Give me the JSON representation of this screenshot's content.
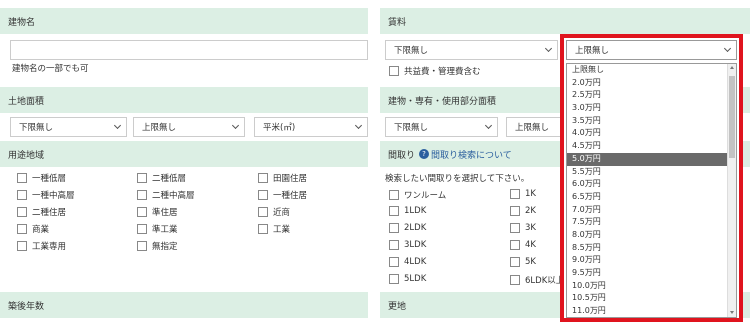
{
  "building_name": {
    "header": "建物名",
    "hint": "建物名の一部でも可"
  },
  "rent": {
    "header": "賃料",
    "lower_value": "下限無し",
    "upper_value": "上限無し",
    "common_fee_label": "共益費・管理費含む",
    "options": [
      "上限無し",
      "2.0万円",
      "2.5万円",
      "3.0万円",
      "3.5万円",
      "4.0万円",
      "4.5万円",
      "5.0万円",
      "5.5万円",
      "6.0万円",
      "6.5万円",
      "7.0万円",
      "7.5万円",
      "8.0万円",
      "8.5万円",
      "9.0万円",
      "9.5万円",
      "10.0万円",
      "10.5万円",
      "11.0万円"
    ],
    "highlighted_option": "5.0万円"
  },
  "land_area": {
    "header": "土地面積",
    "lower_value": "下限無し",
    "upper_value": "上限無し",
    "unit_value": "平米(㎡)"
  },
  "building_area": {
    "header": "建物・専有・使用部分面積",
    "lower_value": "下限無し",
    "upper_value": "上限無し"
  },
  "zoning": {
    "header": "用途地域",
    "col1": [
      "一種低層",
      "一種中高層",
      "二種住居",
      "商業",
      "工業専用"
    ],
    "col2": [
      "二種低層",
      "二種中高層",
      "準住居",
      "準工業",
      "無指定"
    ],
    "col3": [
      "田園住居",
      "一種住居",
      "近商",
      "工業"
    ]
  },
  "layout": {
    "header": "間取り",
    "help_link": "間取り検索について",
    "instruction": "検索したい間取りを選択して下さい。",
    "col1": [
      "ワンルーム",
      "1LDK",
      "2LDK",
      "3LDK",
      "4LDK",
      "5LDK"
    ],
    "col2": [
      "1K",
      "2K",
      "3K",
      "4K",
      "5K",
      "6LDK以上"
    ]
  },
  "building_age": {
    "header": "築後年数"
  },
  "address": {
    "header": "更地"
  }
}
